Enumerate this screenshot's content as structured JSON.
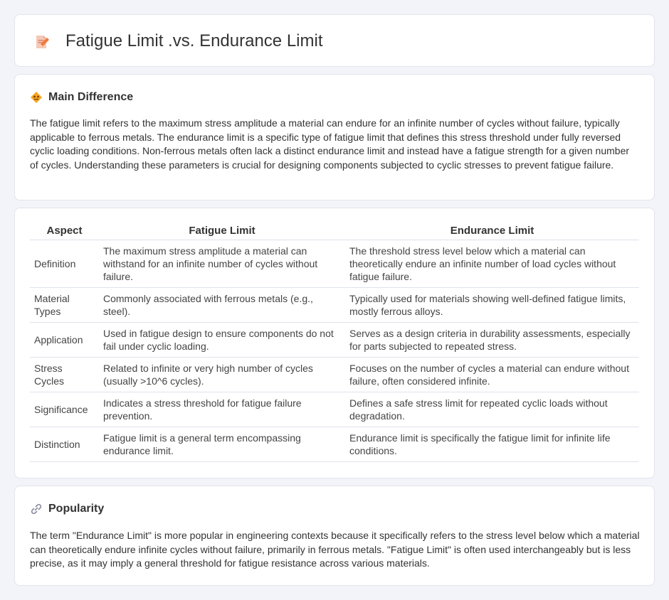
{
  "header": {
    "title": "Fatigue Limit .vs. Endurance Limit",
    "icon": "document-pencil-icon"
  },
  "main_difference": {
    "heading": "Main Difference",
    "icon": "diamond-warning-icon",
    "text": "The fatigue limit refers to the maximum stress amplitude a material can endure for an infinite number of cycles without failure, typically applicable to ferrous metals. The endurance limit is a specific type of fatigue limit that defines this stress threshold under fully reversed cyclic loading conditions. Non-ferrous metals often lack a distinct endurance limit and instead have a fatigue strength for a given number of cycles. Understanding these parameters is crucial for designing components subjected to cyclic stresses to prevent fatigue failure."
  },
  "comparison": {
    "headers": [
      "Aspect",
      "Fatigue Limit",
      "Endurance Limit"
    ],
    "rows": [
      {
        "aspect": "Definition",
        "fatigue": "The maximum stress amplitude a material can withstand for an infinite number of cycles without failure.",
        "endurance": "The threshold stress level below which a material can theoretically endure an infinite number of load cycles without fatigue failure."
      },
      {
        "aspect": "Material Types",
        "fatigue": "Commonly associated with ferrous metals (e.g., steel).",
        "endurance": "Typically used for materials showing well-defined fatigue limits, mostly ferrous alloys."
      },
      {
        "aspect": "Application",
        "fatigue": "Used in fatigue design to ensure components do not fail under cyclic loading.",
        "endurance": "Serves as a design criteria in durability assessments, especially for parts subjected to repeated stress."
      },
      {
        "aspect": "Stress Cycles",
        "fatigue": "Related to infinite or very high number of cycles (usually >10^6 cycles).",
        "endurance": "Focuses on the number of cycles a material can endure without failure, often considered infinite."
      },
      {
        "aspect": "Significance",
        "fatigue": "Indicates a stress threshold for fatigue failure prevention.",
        "endurance": "Defines a safe stress limit for repeated cyclic loads without degradation."
      },
      {
        "aspect": "Distinction",
        "fatigue": "Fatigue limit is a general term encompassing endurance limit.",
        "endurance": "Endurance limit is specifically the fatigue limit for infinite life conditions."
      }
    ]
  },
  "popularity": {
    "heading": "Popularity",
    "icon": "link-icon",
    "text": "The term \"Endurance Limit\" is more popular in engineering contexts because it specifically refers to the stress level below which a material can theoretically endure infinite cycles without failure, primarily in ferrous metals. \"Fatigue Limit\" is often used interchangeably but is less precise, as it may imply a general threshold for fatigue resistance across various materials."
  }
}
